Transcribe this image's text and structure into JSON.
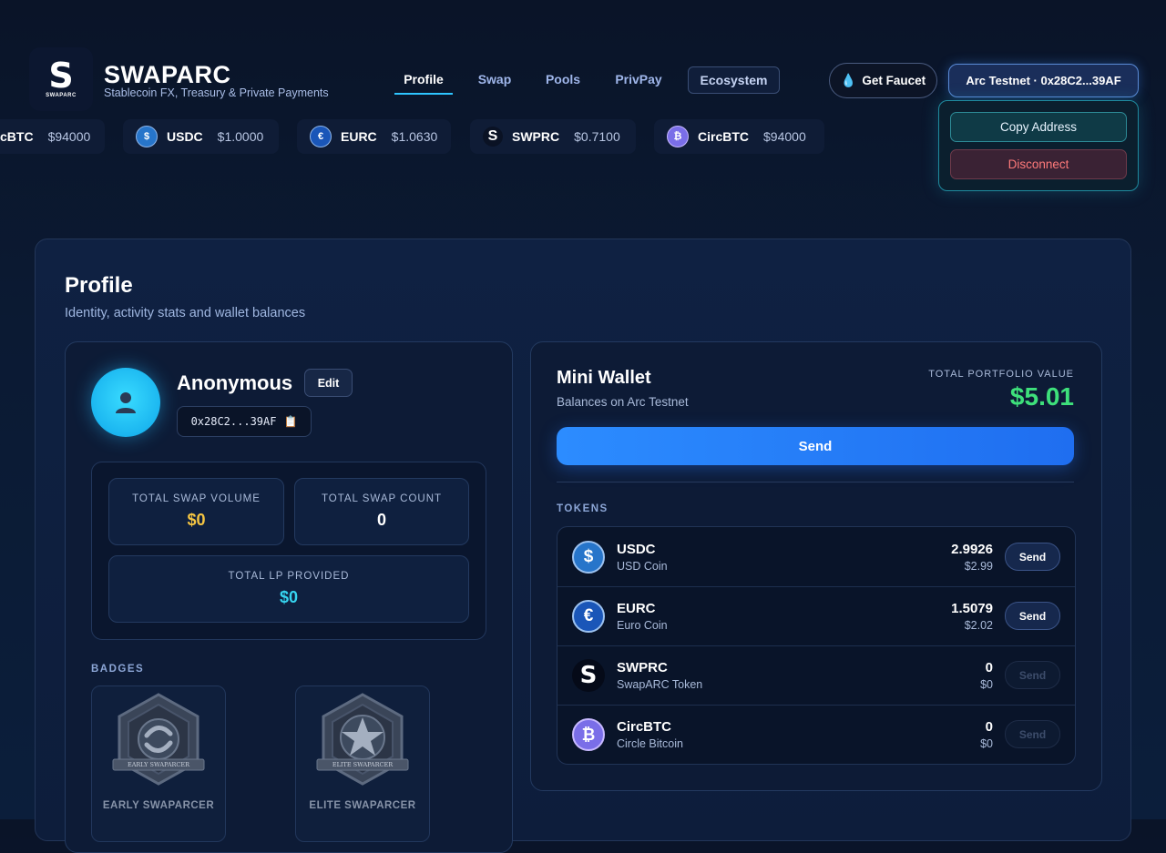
{
  "brand": {
    "logo_letter": "S",
    "logo_small": "SWAPARC",
    "name": "SWAPARC",
    "tagline": "Stablecoin FX, Treasury & Private Payments"
  },
  "nav": [
    {
      "label": "Profile",
      "active": true
    },
    {
      "label": "Swap"
    },
    {
      "label": "Pools"
    },
    {
      "label": "PrivPay"
    },
    {
      "label": "Ecosystem"
    }
  ],
  "header": {
    "faucet_label": "Get Faucet",
    "wallet_label": "Arc Testnet · 0x28C2...39AF",
    "dropdown": {
      "copy_label": "Copy Address",
      "disconnect_label": "Disconnect"
    }
  },
  "ticker": [
    {
      "symbol": "cBTC",
      "price": "$94000",
      "icon": "circbtc-icon"
    },
    {
      "symbol": "USDC",
      "price": "$1.0000",
      "icon": "usdc-icon"
    },
    {
      "symbol": "EURC",
      "price": "$1.0630",
      "icon": "eurc-icon"
    },
    {
      "symbol": "SWPRC",
      "price": "$0.7100",
      "icon": "swprc-icon"
    },
    {
      "symbol": "CircBTC",
      "price": "$94000",
      "icon": "circbtc-icon"
    }
  ],
  "page": {
    "title": "Profile",
    "subtitle": "Identity, activity stats and wallet balances"
  },
  "profile": {
    "name": "Anonymous",
    "edit_label": "Edit",
    "address": "0x28C2...39AF",
    "stats": [
      {
        "label": "TOTAL SWAP VOLUME",
        "value": "$0",
        "color": "#f5c542"
      },
      {
        "label": "TOTAL SWAP COUNT",
        "value": "0",
        "color": "#ffffff"
      },
      {
        "label": "TOTAL LP PROVIDED",
        "value": "$0",
        "color": "#36d4f0"
      }
    ],
    "badges_heading": "BADGES",
    "badges": [
      {
        "label": "EARLY SWAPARCER",
        "art_text": "EARLY SWAPARCER"
      },
      {
        "label": "ELITE SWAPARCER",
        "art_text": "ELITE SWAPARCER"
      }
    ]
  },
  "wallet": {
    "title": "Mini Wallet",
    "subtitle": "Balances on Arc Testnet",
    "total_label": "TOTAL PORTFOLIO VALUE",
    "total_value": "$5.01",
    "send_label": "Send",
    "tokens_heading": "TOKENS",
    "tokens": [
      {
        "symbol": "USDC",
        "name": "USD Coin",
        "amount": "2.9926",
        "usd": "$2.99",
        "send_label": "Send",
        "enabled": true,
        "icon": "usdc-icon"
      },
      {
        "symbol": "EURC",
        "name": "Euro Coin",
        "amount": "1.5079",
        "usd": "$2.02",
        "send_label": "Send",
        "enabled": true,
        "icon": "eurc-icon"
      },
      {
        "symbol": "SWPRC",
        "name": "SwapARC Token",
        "amount": "0",
        "usd": "$0",
        "send_label": "Send",
        "enabled": false,
        "icon": "swprc-icon"
      },
      {
        "symbol": "CircBTC",
        "name": "Circle Bitcoin",
        "amount": "0",
        "usd": "$0",
        "send_label": "Send",
        "enabled": false,
        "icon": "circbtc-icon"
      }
    ]
  },
  "colors": {
    "accent": "#2ec5ff",
    "total_value": "#3ee07b",
    "disconnect": "#ff7a7a"
  }
}
